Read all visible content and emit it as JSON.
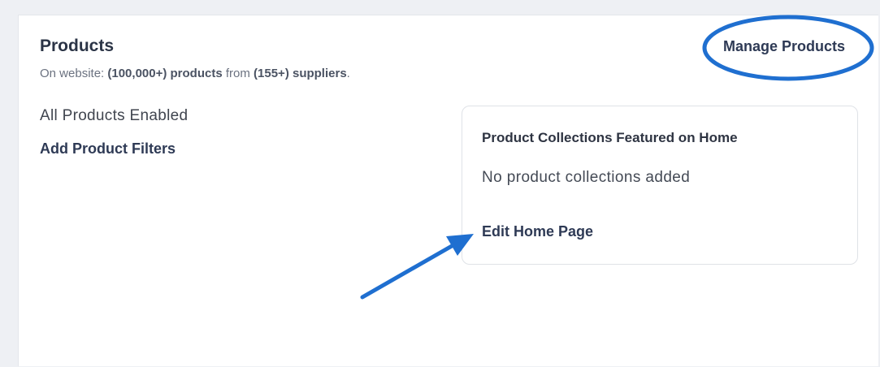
{
  "products": {
    "title": "Products",
    "subtitle": {
      "prefix": "On website: ",
      "product_count": "(100,000+) products",
      "middle": " from ",
      "supplier_count": "(155+) suppliers",
      "suffix": "."
    },
    "manage_label": "Manage Products",
    "status_text": "All Products Enabled",
    "add_filters_label": "Add Product Filters"
  },
  "collections_panel": {
    "title": "Product Collections Featured on Home",
    "empty_text": "No product collections added",
    "edit_label": "Edit Home Page"
  },
  "annotations": {
    "color": "#1f6fd0",
    "circle_target": "Manage Products",
    "arrow_target": "Edit Home Page"
  }
}
